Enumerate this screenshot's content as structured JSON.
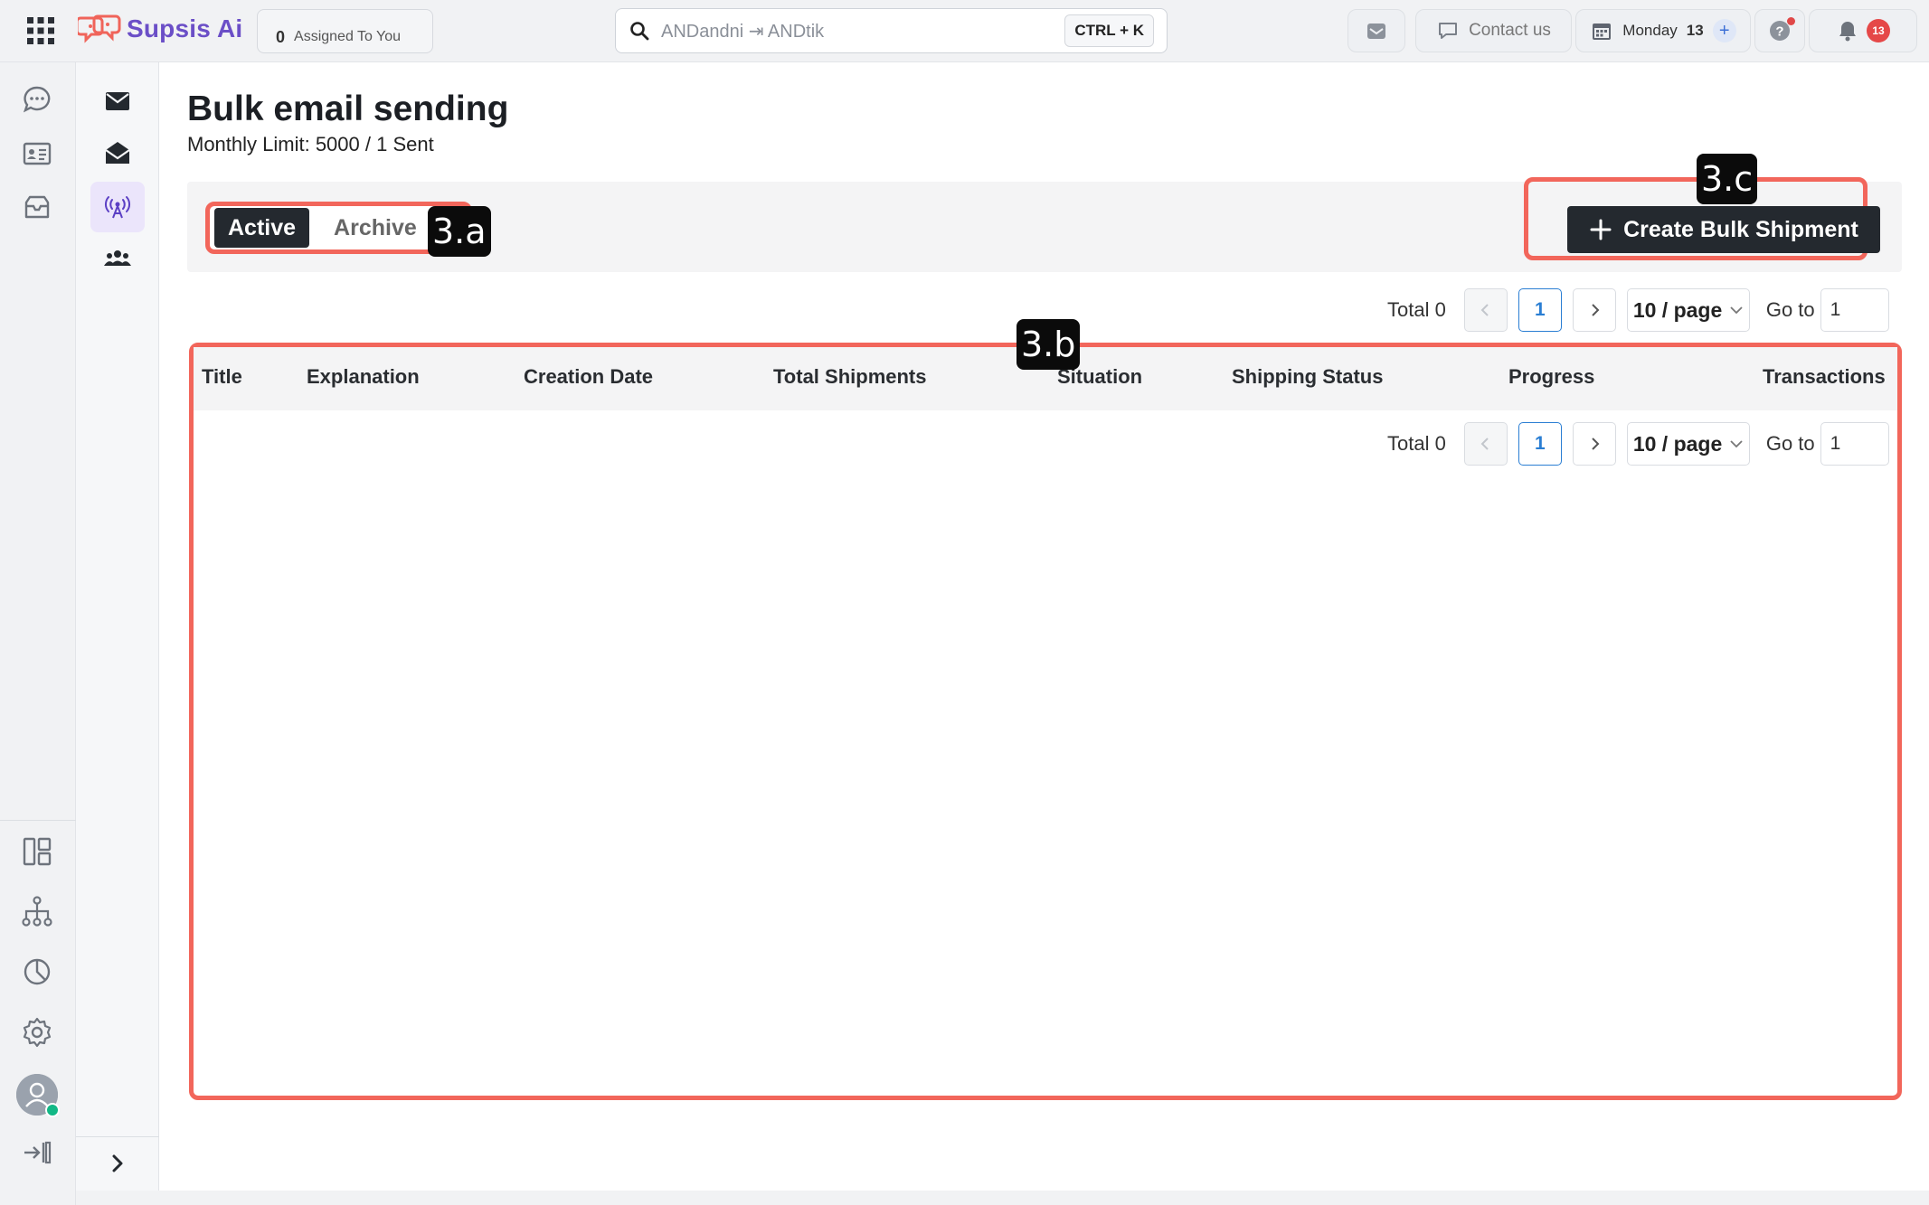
{
  "topbar": {
    "brand": "Supsis Ai",
    "assigned": {
      "count": "0",
      "label": "Assigned To You"
    },
    "search": {
      "value": "ANDandni ⇥ ANDtik",
      "shortcut": "CTRL + K"
    },
    "contact_label": "Contact us",
    "calendar": {
      "day": "Monday",
      "date": "13"
    },
    "notifications_count": "13"
  },
  "rail1": {
    "icons": [
      "chat-icon",
      "contact-card-icon",
      "inbox-icon",
      "dashboard-icon",
      "flow-icon",
      "report-icon",
      "settings-icon",
      "logout-icon"
    ]
  },
  "rail2": {
    "icons": [
      "mail-icon",
      "open-mail-icon",
      "broadcast-icon",
      "team-icon"
    ],
    "active": "broadcast-icon"
  },
  "page": {
    "title": "Bulk email sending",
    "subtitle": "Monthly Limit: 5000 / 1 Sent"
  },
  "tabs": {
    "active": "Active",
    "archive": "Archive"
  },
  "create_button": "Create Bulk Shipment",
  "annotations": {
    "tabs": "3.a",
    "table": "3.b",
    "create": "3.c"
  },
  "pagination": {
    "total_label": "Total 0",
    "current_page": "1",
    "page_size": "10 / page",
    "goto_label": "Go to",
    "goto_value": "1"
  },
  "table": {
    "columns": [
      "Title",
      "Explanation",
      "Creation Date",
      "Total Shipments",
      "Situation",
      "Shipping Status",
      "Progress",
      "Transactions"
    ]
  },
  "colors": {
    "annotation_frame": "#f2665b",
    "primary_dark": "#24292f",
    "brand_purple": "#6b4fc7",
    "link_blue": "#2a7ed3",
    "badge_red": "#e54848"
  }
}
